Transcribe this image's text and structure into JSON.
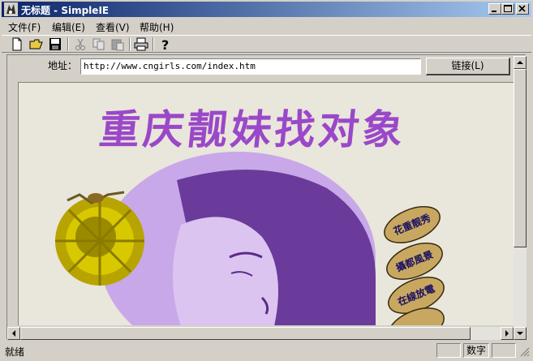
{
  "window": {
    "title": "无标题 - SimpleIE"
  },
  "menu": [
    {
      "label": "文件(F)"
    },
    {
      "label": "编辑(E)"
    },
    {
      "label": "查看(V)"
    },
    {
      "label": "帮助(H)"
    }
  ],
  "toolbar": {
    "icons": [
      "new-file-icon",
      "open-folder-icon",
      "save-icon",
      "cut-icon",
      "copy-icon",
      "paste-icon",
      "print-icon",
      "help-icon"
    ]
  },
  "address": {
    "label": "地址：",
    "value": "http://www.cngirls.com/index.htm",
    "go_label": "链接(L)"
  },
  "page": {
    "headline": "重庆靓妹找对象",
    "buttons": [
      "花重靓秀",
      "攝都風景",
      "在線放電"
    ],
    "colors": {
      "headline": "#9a48c8",
      "background": "#e9e6dc",
      "portrait_dark": "#6a3b9a",
      "portrait_light": "#c8a8e8",
      "flower": "#c8b400"
    }
  },
  "status": {
    "text": "就绪",
    "num_label": "数字"
  }
}
